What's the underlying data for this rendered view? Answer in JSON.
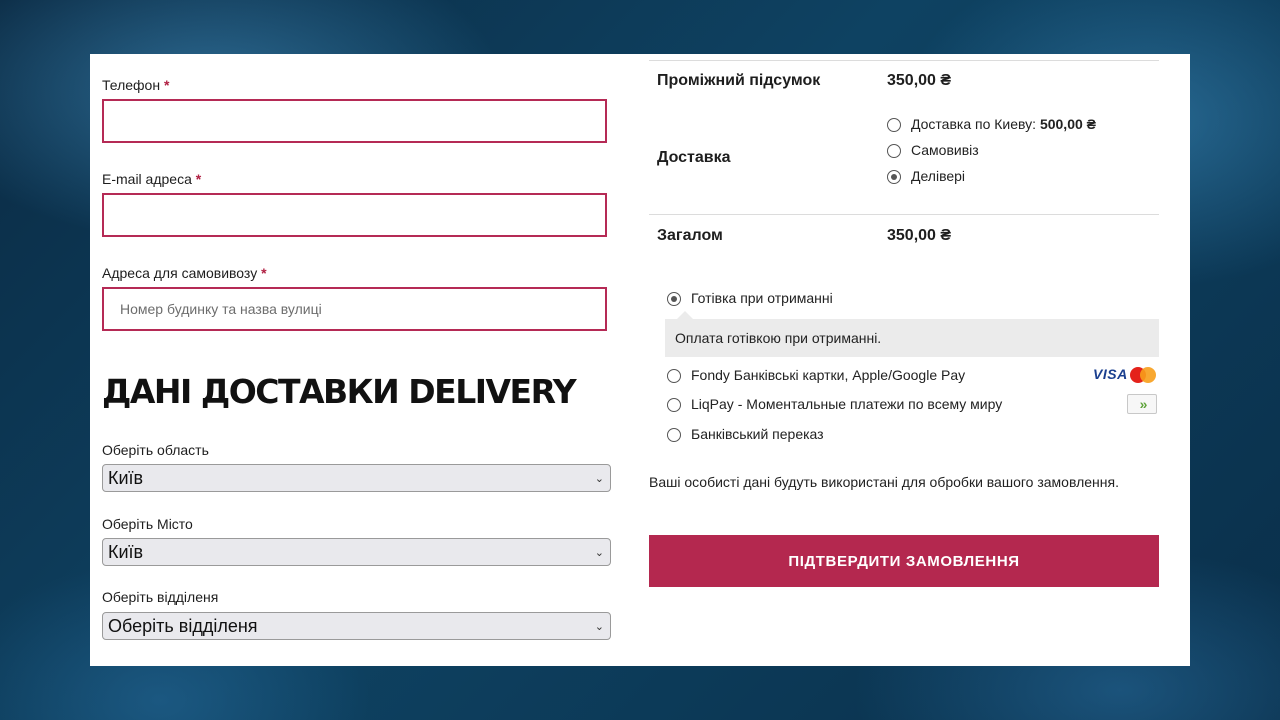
{
  "billing": {
    "phone_label": "Телефон",
    "email_label": "E-mail адреса",
    "address_label": "Адреса для самовивозу",
    "required_mark": "*",
    "phone_value": "",
    "email_value": "",
    "address_placeholder": "Номер будинку та назва вулиці"
  },
  "delivery": {
    "title": "ДАНІ ДОСТАВКИ DELIVERY",
    "region_label": "Оберіть область",
    "region_value": "Київ",
    "city_label": "Оберіть Місто",
    "city_value": "Київ",
    "branch_label": "Оберіть відділеня",
    "branch_value": "Оберіть відділеня"
  },
  "summary": {
    "subtotal_label": "Проміжний підсумок",
    "subtotal_value": "350,00 ₴",
    "shipping_label": "Доставка",
    "shipping_options": [
      {
        "label": "Доставка по Киеву:",
        "price": "500,00 ₴",
        "checked": false
      },
      {
        "label": "Самовивіз",
        "price": "",
        "checked": false
      },
      {
        "label": "Делівері",
        "price": "",
        "checked": true
      }
    ],
    "total_label": "Загалом",
    "total_value": "350,00 ₴"
  },
  "payment": {
    "methods": [
      {
        "label": "Готівка при отриманні",
        "checked": true
      },
      {
        "label": "Fondy Банківські картки, Apple/Google Pay",
        "checked": false
      },
      {
        "label": "LiqPay - Моментальные платежи по всему миру",
        "checked": false
      },
      {
        "label": "Банківський переказ",
        "checked": false
      }
    ],
    "cod_description": "Оплата готівкою при отриманні.",
    "visa_logo": "VISA",
    "liqpay_logo": "»"
  },
  "privacy_text": "Ваші особисті дані будуть використані для обробки вашого замовлення.",
  "confirm_button": "ПІДТВЕРДИТИ ЗАМОВЛЕННЯ",
  "colors": {
    "accent": "#b4284f",
    "input_border": "#b52a55",
    "background": "#0e4262"
  }
}
